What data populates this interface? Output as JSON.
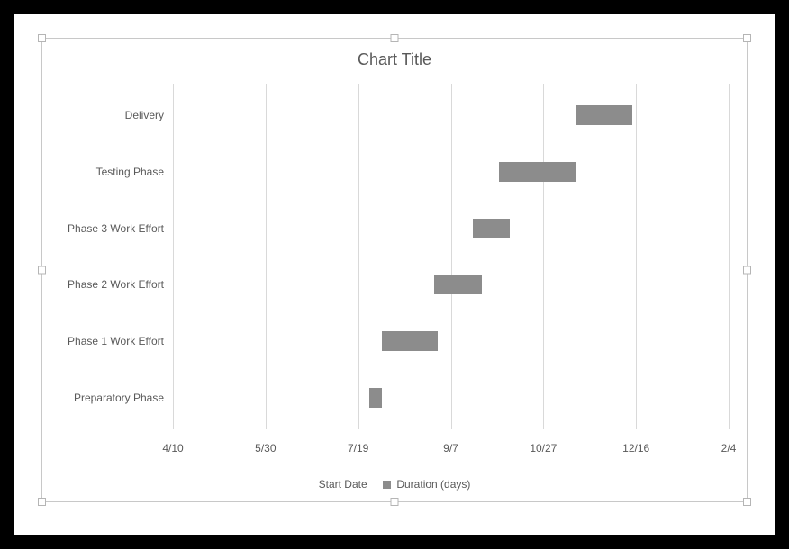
{
  "chart_data": {
    "type": "bar",
    "orientation": "horizontal-stacked-gantt",
    "title": "Chart Title",
    "categories": [
      "Preparatory Phase",
      "Phase 1 Work Effort",
      "Phase 2 Work Effort",
      "Phase 3 Work Effort",
      "Testing Phase",
      "Delivery"
    ],
    "x_ticks": [
      "4/10",
      "5/30",
      "7/19",
      "9/7",
      "10/27",
      "12/16",
      "2/4"
    ],
    "x_min_serial": 42104,
    "x_max_serial": 42404,
    "x_tick_interval_days": 50,
    "series": [
      {
        "name": "Start Date",
        "fill": "none",
        "values": [
          42210,
          42217,
          42245,
          42266,
          42280,
          42322
        ]
      },
      {
        "name": "Duration (days)",
        "fill": "#8c8c8c",
        "values": [
          7,
          30,
          26,
          20,
          42,
          30
        ]
      }
    ]
  }
}
